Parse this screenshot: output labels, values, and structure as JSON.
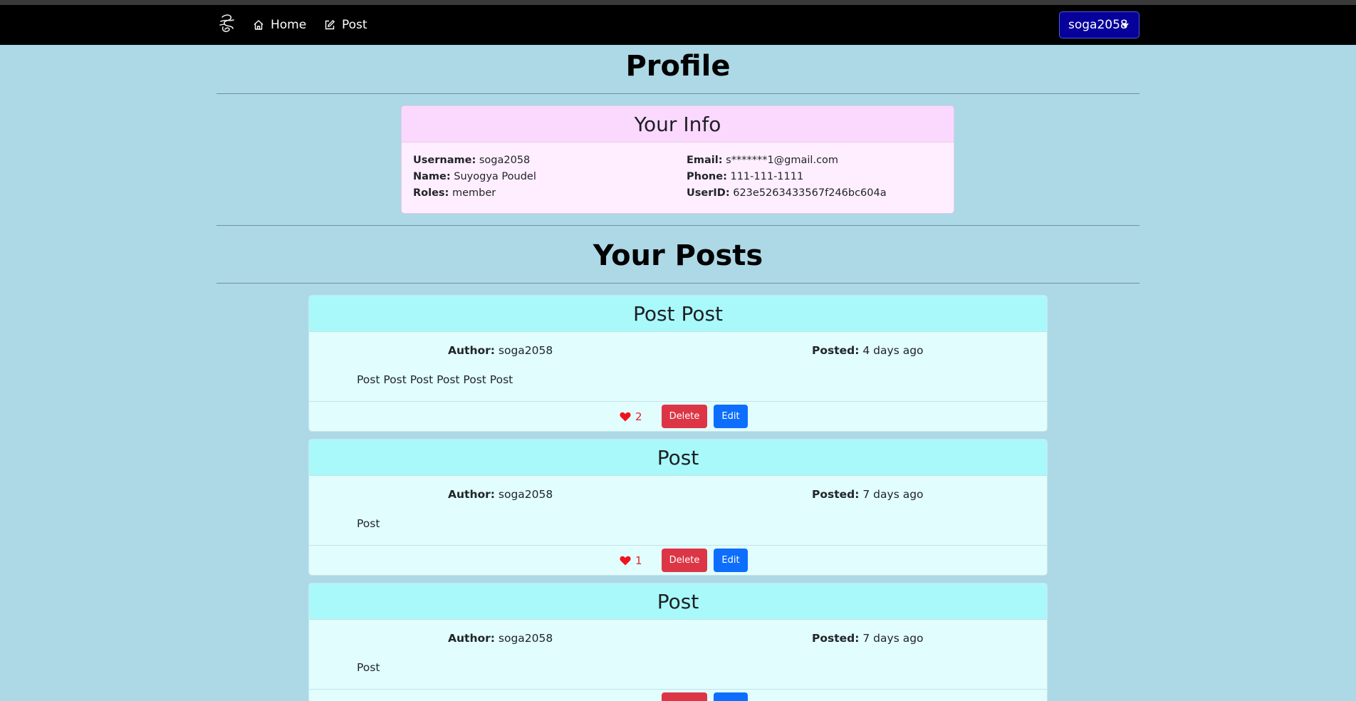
{
  "nav": {
    "home_label": "Home",
    "post_label": "Post",
    "user_label": "soga2058"
  },
  "page_title": "Profile",
  "info": {
    "title": "Your Info",
    "username_label": "Username:",
    "username": "soga2058",
    "name_label": "Name:",
    "name": "Suyogya Poudel",
    "roles_label": "Roles:",
    "roles": "member",
    "email_label": "Email:",
    "email": "s*******1@gmail.com",
    "phone_label": "Phone:",
    "phone": "111-111-1111",
    "userid_label": "UserID:",
    "userid": "623e5263433567f246bc604a"
  },
  "posts_title": "Your Posts",
  "posts": [
    {
      "title": "Post Post",
      "author_label": "Author:",
      "author": "soga2058",
      "posted_label": "Posted:",
      "posted": "4 days ago",
      "body": "Post Post Post Post Post Post",
      "likes": "2",
      "delete_label": "Delete",
      "edit_label": "Edit"
    },
    {
      "title": "Post",
      "author_label": "Author:",
      "author": "soga2058",
      "posted_label": "Posted:",
      "posted": "7 days ago",
      "body": "Post",
      "likes": "1",
      "delete_label": "Delete",
      "edit_label": "Edit"
    },
    {
      "title": "Post",
      "author_label": "Author:",
      "author": "soga2058",
      "posted_label": "Posted:",
      "posted": "7 days ago",
      "body": "Post",
      "likes": "",
      "delete_label": "",
      "edit_label": ""
    }
  ],
  "colors": {
    "page_bg": "#add8e6",
    "navbar_bg": "#000000",
    "user_button_bg": "#07009a",
    "info_header_bg": "#fbd8fe",
    "info_body_bg": "#ffeeff",
    "post_header_bg": "#a9f9fb",
    "post_body_bg": "#e1fdfe",
    "delete_button": "#dc3545",
    "edit_button": "#0d6efd",
    "heart": "#e0242d"
  }
}
